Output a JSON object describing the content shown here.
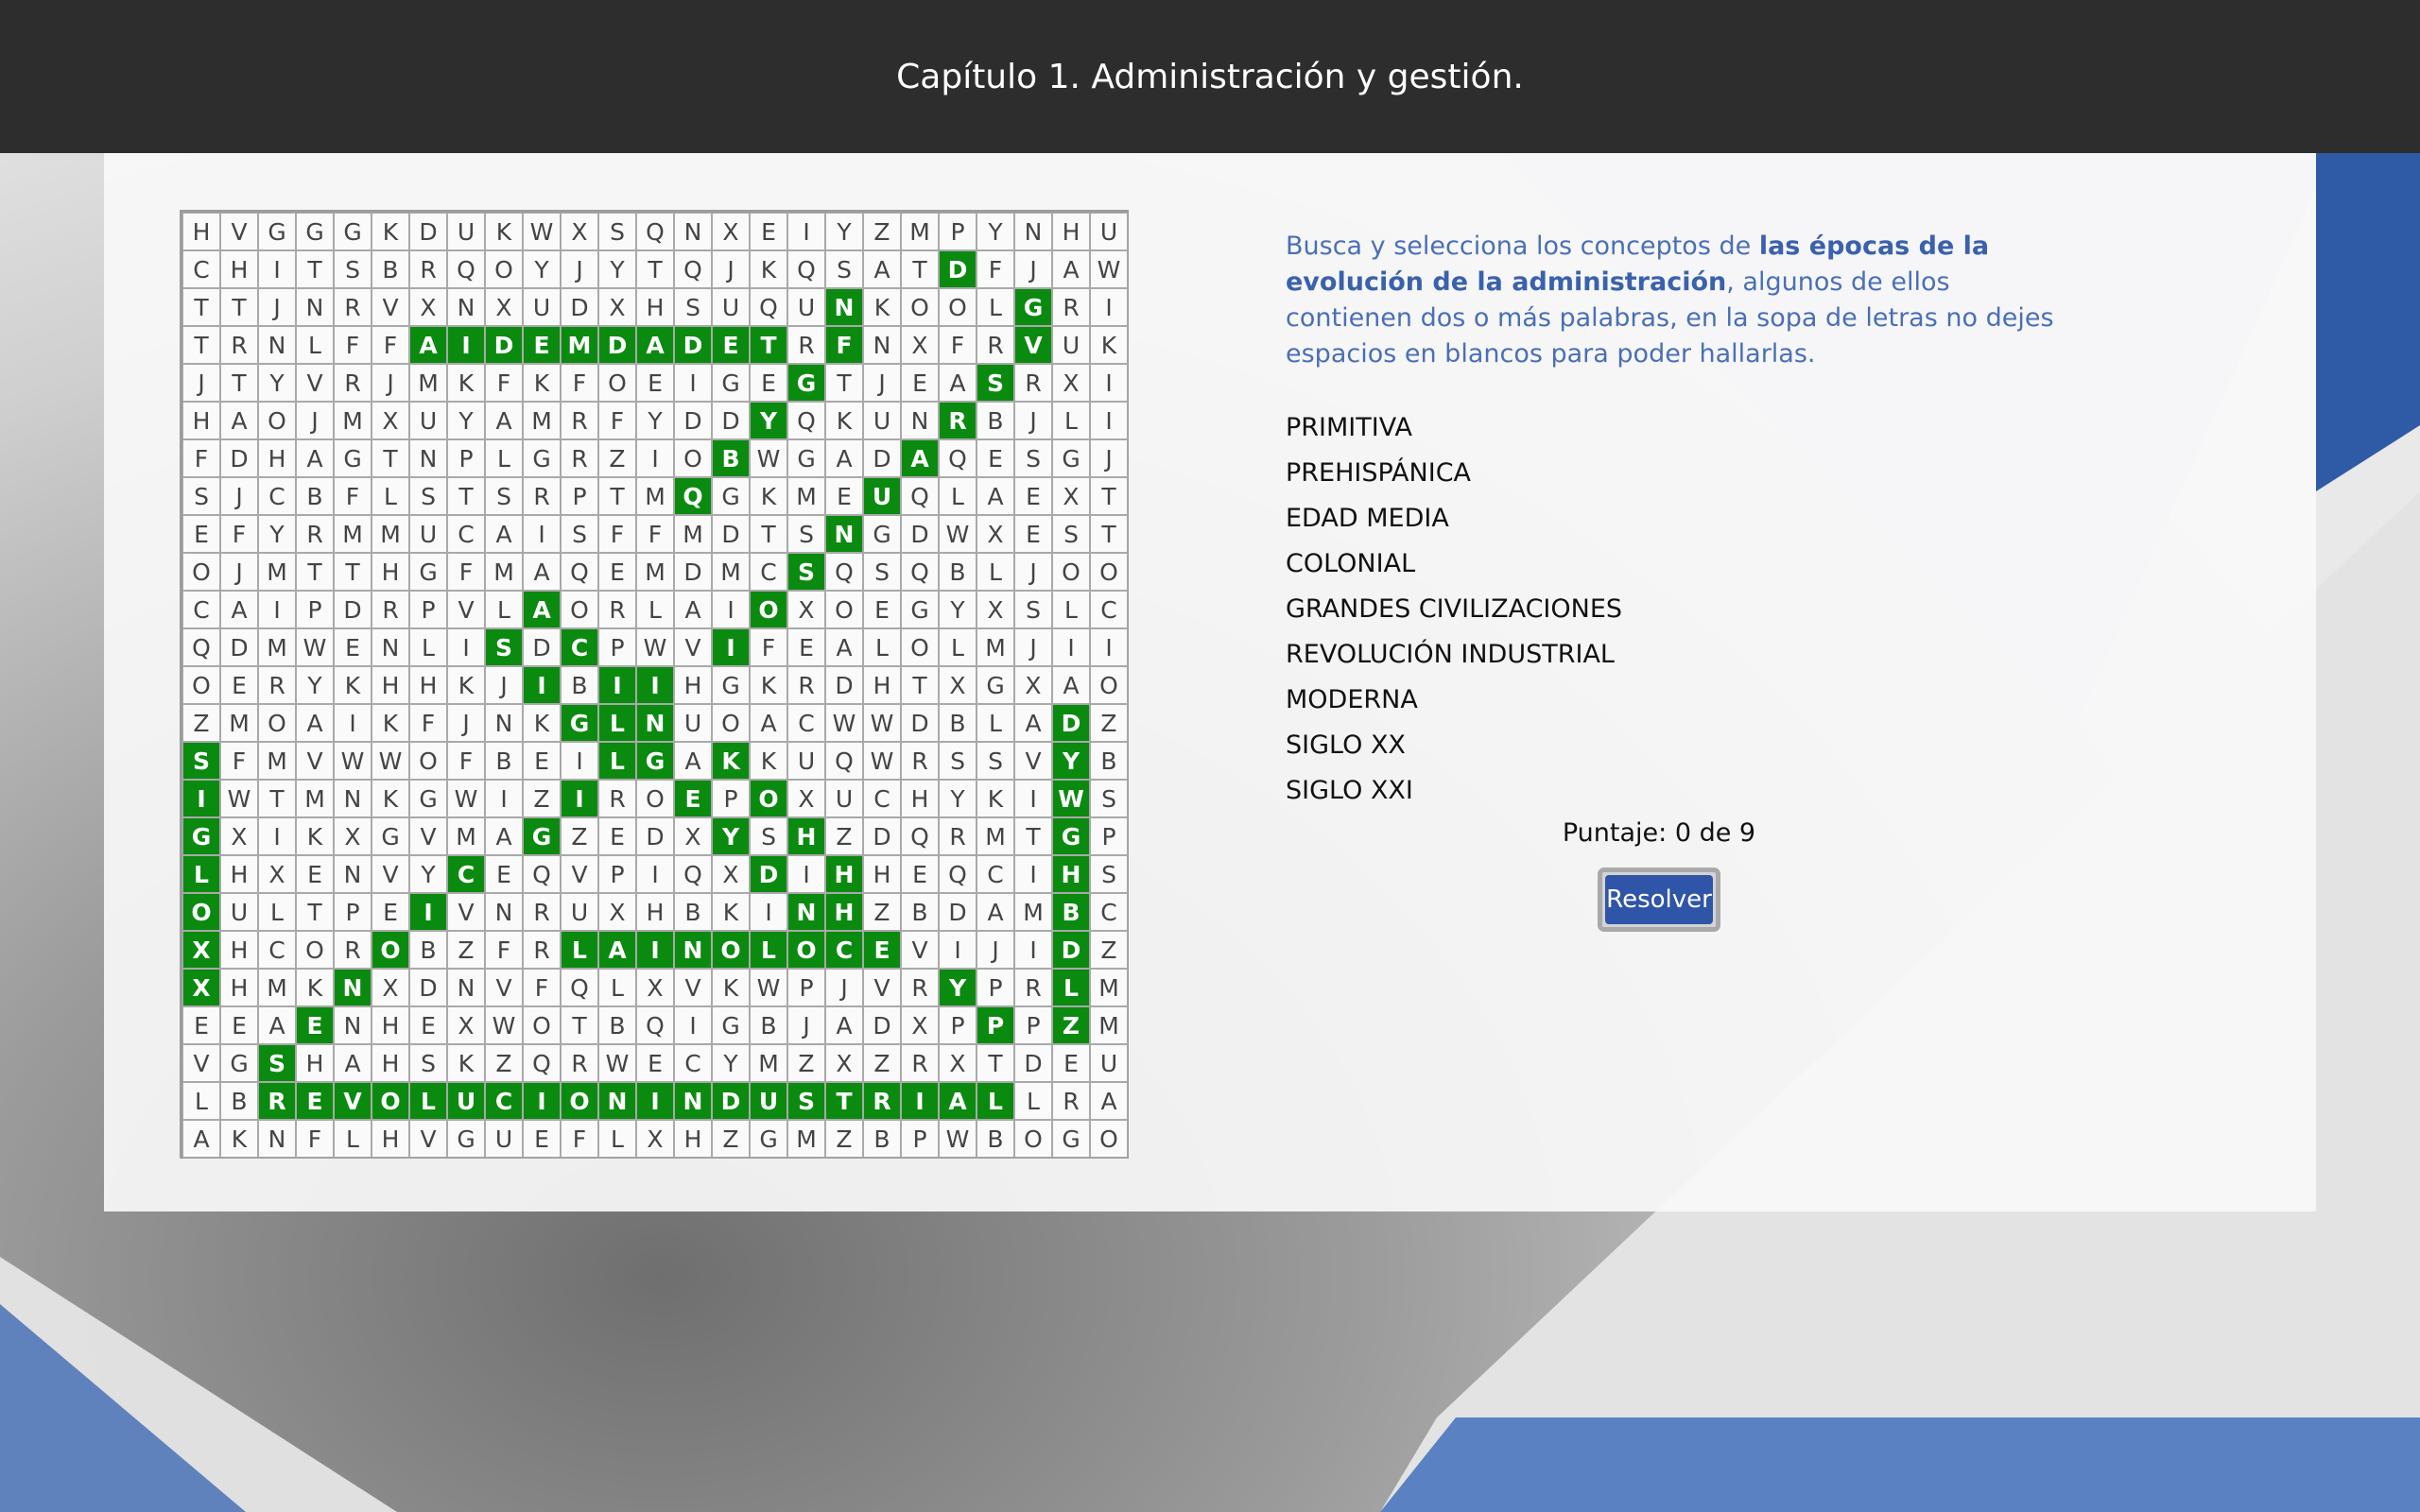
{
  "header": {
    "title": "Capítulo 1. Administración y gestión."
  },
  "instructions": {
    "part1": "Busca y selecciona los conceptos de ",
    "bold": "las épocas de la evolución de la administración",
    "part2": ", algunos de ellos contienen dos o más palabras, en la sopa de letras no dejes espacios en blancos para poder hallarlas."
  },
  "words": [
    "PRIMITIVA",
    "PREHISPÁNICA",
    "EDAD MEDIA",
    "COLONIAL",
    "GRANDES CIVILIZACIONES",
    "REVOLUCIÓN INDUSTRIAL",
    "MODERNA",
    "SIGLO XX",
    "SIGLO XXI"
  ],
  "score_text": "Puntaje: 0 de 9",
  "resolve_label": "Resolver",
  "colors": {
    "found": "#0b8a10",
    "accent": "#2f55a8",
    "text_blue": "#4a6fb5"
  },
  "grid": [
    "HVGGGKDUKWXSQNXEIYZMPYNHU",
    "CHITSBRQOYJYTQJKQSATDFJAW",
    "TTJNRVXNXUDXHSUQUNKOOLGRI",
    "TRNLFFAIDEMDADETRFNXFRVUK",
    "JTYVRJMKFKFOEIGEGTJEASRXI",
    "HAOJMXUYAMRFYDDYQKUNRBJLI",
    "FDHAGTNPLGRZIOBWGADAQESGJ",
    "SJCBFLSTSRPTMQGKMEUQLAEXT",
    "EFYRMMUCAISFFMDTSNGDWXEST",
    "OJMTTHGFMAQEMDMCSQSQBLJOO",
    "CAIPDRPVLAORLAIOXOEGYXSLC",
    "QDMWENLISDCPWVIFEALOLMJII",
    "OERYKHHKJIBIIHGKRDHTXGXAO",
    "ZMOAIKFJNKGLNUOACWWDBLADZ",
    "SFMVWWOFBEILGAKKUQWRSSVYB",
    "IWTMNKGWIZIROEPOXUCHYKIWS",
    "GXIKXGVMAGZEDXYSHZDQRMTGP",
    "LHXENVYCEQVPIQXDIHHEQCIHS",
    "OULTPEIVNRUXHBKINHZBDAMBC",
    "XHCOROBZFRLAINOLOCEVIJIDZ",
    "XHMKNXDNVFQLXVKWPJVRYPRLM",
    "EEAENHEXWOTBQIGBJADXPPPZM",
    "VGSHAHSKZQRWECYMZXZRXTDEU",
    "LBREVOLUCIONINDUSTRIALLRA",
    "AKNFLHVGUEFLXHZGMZBPWBOGO"
  ],
  "found_cells": [
    [
      1,
      20
    ],
    [
      2,
      17
    ],
    [
      2,
      22
    ],
    [
      3,
      6
    ],
    [
      3,
      7
    ],
    [
      3,
      8
    ],
    [
      3,
      9
    ],
    [
      3,
      10
    ],
    [
      3,
      11
    ],
    [
      3,
      12
    ],
    [
      3,
      13
    ],
    [
      3,
      14
    ],
    [
      3,
      15
    ],
    [
      3,
      17
    ],
    [
      3,
      22
    ],
    [
      4,
      16
    ],
    [
      4,
      21
    ],
    [
      5,
      15
    ],
    [
      5,
      20
    ],
    [
      6,
      14
    ],
    [
      6,
      19
    ],
    [
      7,
      13
    ],
    [
      7,
      18
    ],
    [
      8,
      17
    ],
    [
      9,
      16
    ],
    [
      10,
      9
    ],
    [
      10,
      15
    ],
    [
      11,
      8
    ],
    [
      11,
      10
    ],
    [
      11,
      14
    ],
    [
      12,
      9
    ],
    [
      12,
      11
    ],
    [
      12,
      12
    ],
    [
      13,
      10
    ],
    [
      13,
      11
    ],
    [
      13,
      12
    ],
    [
      13,
      23
    ],
    [
      14,
      0
    ],
    [
      14,
      11
    ],
    [
      14,
      12
    ],
    [
      14,
      14
    ],
    [
      14,
      23
    ],
    [
      15,
      0
    ],
    [
      15,
      10
    ],
    [
      15,
      13
    ],
    [
      15,
      15
    ],
    [
      15,
      23
    ],
    [
      16,
      0
    ],
    [
      16,
      9
    ],
    [
      16,
      14
    ],
    [
      16,
      16
    ],
    [
      16,
      23
    ],
    [
      17,
      0
    ],
    [
      17,
      7
    ],
    [
      17,
      15
    ],
    [
      17,
      17
    ],
    [
      17,
      23
    ],
    [
      18,
      0
    ],
    [
      18,
      6
    ],
    [
      18,
      16
    ],
    [
      18,
      17
    ],
    [
      18,
      23
    ],
    [
      19,
      0
    ],
    [
      19,
      5
    ],
    [
      19,
      10
    ],
    [
      19,
      11
    ],
    [
      19,
      12
    ],
    [
      19,
      13
    ],
    [
      19,
      14
    ],
    [
      19,
      15
    ],
    [
      19,
      16
    ],
    [
      19,
      17
    ],
    [
      19,
      18
    ],
    [
      19,
      23
    ],
    [
      20,
      0
    ],
    [
      20,
      4
    ],
    [
      20,
      20
    ],
    [
      20,
      23
    ],
    [
      21,
      3
    ],
    [
      21,
      21
    ],
    [
      21,
      23
    ],
    [
      22,
      2
    ],
    [
      23,
      2
    ],
    [
      23,
      3
    ],
    [
      23,
      4
    ],
    [
      23,
      5
    ],
    [
      23,
      6
    ],
    [
      23,
      7
    ],
    [
      23,
      8
    ],
    [
      23,
      9
    ],
    [
      23,
      10
    ],
    [
      23,
      11
    ],
    [
      23,
      12
    ],
    [
      23,
      13
    ],
    [
      23,
      14
    ],
    [
      23,
      15
    ],
    [
      23,
      16
    ],
    [
      23,
      17
    ],
    [
      23,
      18
    ],
    [
      23,
      19
    ],
    [
      23,
      20
    ],
    [
      23,
      21
    ]
  ]
}
